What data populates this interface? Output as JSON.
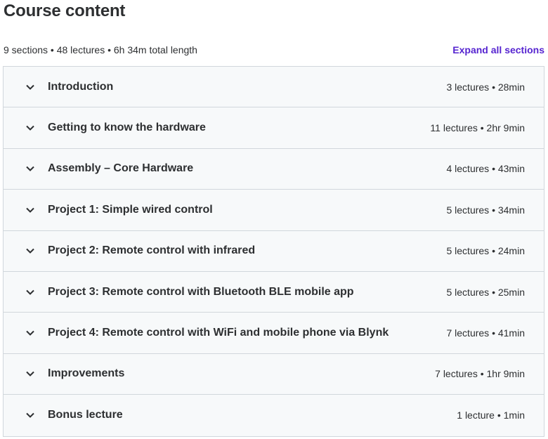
{
  "header": {
    "title": "Course content",
    "summary": "9 sections • 48 lectures • 6h 34m total length",
    "expand_label": "Expand all sections"
  },
  "colors": {
    "accent": "#5624d0",
    "section_bg": "#f7f9fa",
    "border": "#d1d7dc",
    "text": "#2d2f31"
  },
  "sections": [
    {
      "title": "Introduction",
      "meta": "3 lectures • 28min",
      "icon": "chevron-down-icon"
    },
    {
      "title": "Getting to know the hardware",
      "meta": "11 lectures • 2hr 9min",
      "icon": "chevron-down-icon"
    },
    {
      "title": "Assembly – Core Hardware",
      "meta": "4 lectures • 43min",
      "icon": "chevron-down-icon"
    },
    {
      "title": "Project 1: Simple wired control",
      "meta": "5 lectures • 34min",
      "icon": "chevron-down-icon"
    },
    {
      "title": "Project 2: Remote control with infrared",
      "meta": "5 lectures • 24min",
      "icon": "chevron-down-icon"
    },
    {
      "title": "Project 3: Remote control with Bluetooth BLE mobile app",
      "meta": "5 lectures • 25min",
      "icon": "chevron-down-icon"
    },
    {
      "title": "Project 4: Remote control with WiFi and mobile phone via Blynk",
      "meta": "7 lectures • 41min",
      "icon": "chevron-down-icon"
    },
    {
      "title": "Improvements",
      "meta": "7 lectures • 1hr 9min",
      "icon": "chevron-down-icon"
    },
    {
      "title": "Bonus lecture",
      "meta": "1 lecture • 1min",
      "icon": "chevron-down-icon"
    }
  ]
}
